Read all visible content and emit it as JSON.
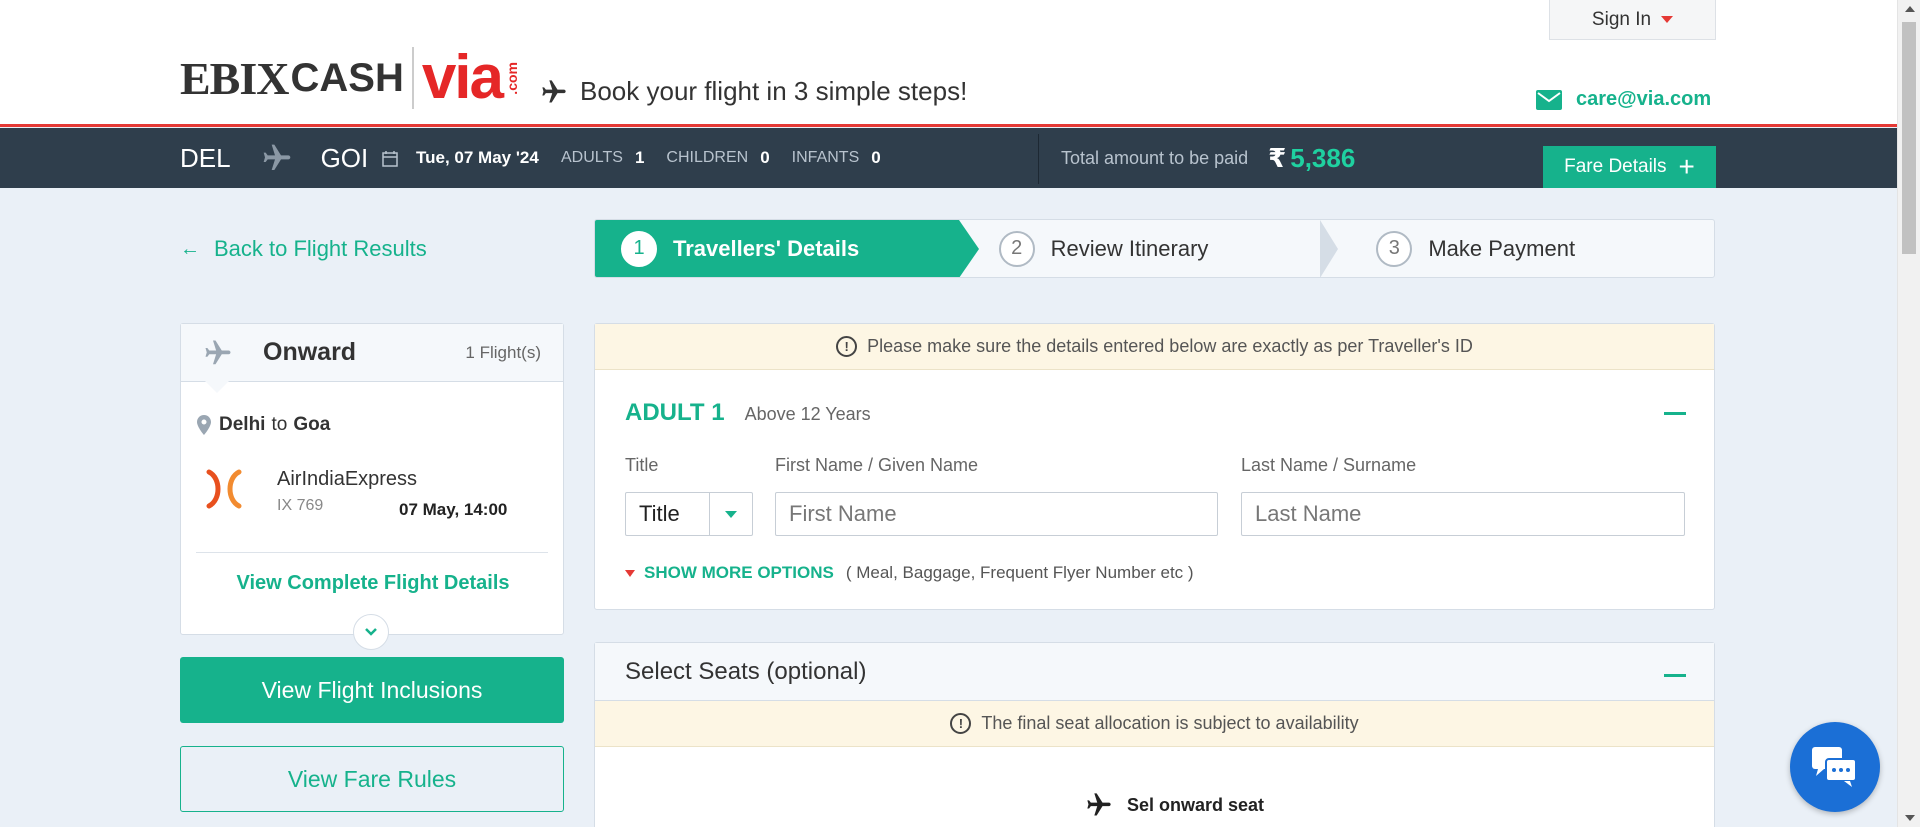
{
  "brand": {
    "ebix": "EBIX",
    "cash": "CASH",
    "via": "via",
    "com": ".com"
  },
  "header": {
    "tagline": "Book your flight in 3 simple steps!",
    "signin": "Sign In",
    "email": "care@via.com"
  },
  "trip": {
    "from": "DEL",
    "to": "GOI",
    "date": "Tue, 07 May '24",
    "adults_label": "ADULTS",
    "adults": "1",
    "children_label": "CHILDREN",
    "children": "0",
    "infants_label": "INFANTS",
    "infants": "0",
    "total_label": "Total amount to be paid",
    "currency": "₹",
    "amount": "5,386",
    "fare_details": "Fare Details"
  },
  "back_link": "Back to Flight Results",
  "steps": [
    {
      "num": "1",
      "label": "Travellers' Details"
    },
    {
      "num": "2",
      "label": "Review Itinerary"
    },
    {
      "num": "3",
      "label": "Make Payment"
    }
  ],
  "flight_card": {
    "heading": "Onward",
    "count": "1 Flight(s)",
    "from_city": "Delhi",
    "to_word": "to",
    "to_city": "Goa",
    "airline": "AirIndiaExpress",
    "flight_no": "IX 769",
    "departure": "07 May, 14:00",
    "view_details": "View Complete Flight Details"
  },
  "buttons": {
    "inclusions": "View Flight Inclusions",
    "fare_rules": "View Fare Rules"
  },
  "traveller": {
    "notice": "Please make sure the details entered below are exactly as per Traveller's ID",
    "title": "ADULT 1",
    "subtitle": "Above 12 Years",
    "title_label": "Title",
    "title_value": "Title",
    "first_label": "First Name / Given Name",
    "first_placeholder": "First Name",
    "last_label": "Last Name / Surname",
    "last_placeholder": "Last Name",
    "more_options": "SHOW MORE OPTIONS",
    "more_hint": "( Meal, Baggage, Frequent Flyer Number etc )"
  },
  "seats": {
    "heading": "Select Seats (optional)",
    "notice": "The final seat allocation is subject to availability",
    "select_onward": "Sel onward seat"
  },
  "colors": {
    "accent": "#16b28c",
    "header_bar": "#2f3e4c",
    "brand_red": "#e53935",
    "chat": "#1b6fd6"
  },
  "icons": [
    "plane-icon",
    "mail-icon",
    "calendar-icon",
    "rupee-icon",
    "plus-icon",
    "arrow-left-icon",
    "pin-icon",
    "airline-logo",
    "chevron-down-icon",
    "info-icon",
    "chat-icon"
  ]
}
